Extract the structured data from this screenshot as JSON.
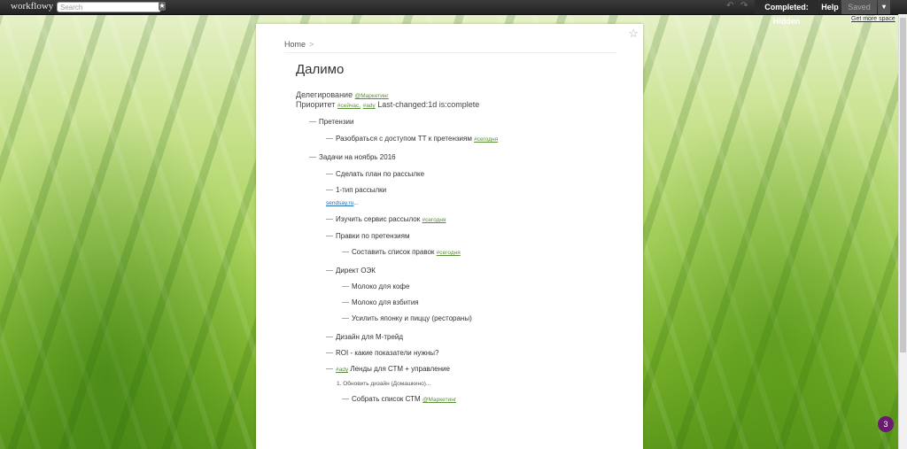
{
  "topbar": {
    "logo": "workflowy",
    "search_placeholder": "Search",
    "completed": "Completed: Hidden",
    "help": "Help",
    "saved": "Saved",
    "more_space": "Get more space"
  },
  "icons": {
    "star": "star-icon",
    "undo": "undo-icon",
    "redo": "redo-icon",
    "dropdown": "chevron-down-icon"
  },
  "page": {
    "breadcrumb": "Home",
    "breadcrumb_sep": ">",
    "title": "Далимо",
    "note_line1": "Делегирование",
    "note_line1_mention": "@Маркетинг",
    "note_line2": "Приоритет",
    "note_line2_tag1": "#сейчас,",
    "note_line2_tag2": "#ady",
    "note_line2_rest": "Last-changed:1d is:complete",
    "items": [
      {
        "text": "Претензии"
      },
      {
        "text": "Разобраться с доступом ТТ к претензиям",
        "tag": "#сегодня"
      },
      {
        "text": "Задачи на ноябрь 2016"
      },
      {
        "text": "Сделать план по рассылке"
      },
      {
        "text": "1-тип рассылки"
      },
      {
        "link": "sendsay.ru",
        "tail": "..."
      },
      {
        "text": "Изучить сервис рассылок",
        "tag": "#сегодня"
      },
      {
        "text": "Правки по претензиям"
      },
      {
        "text": "Составить список правок",
        "tag": "#сегодня"
      },
      {
        "text": "Директ ОЭК"
      },
      {
        "text": "Молоко для кофе"
      },
      {
        "text": "Молоко для взбития"
      },
      {
        "text": "Усилить японку и пиццу (рестораны)"
      },
      {
        "text": "Дизайн для М-трейд"
      },
      {
        "text": "ROI - какие показатели нужны?"
      },
      {
        "tag_prefix": "#ady",
        "text": "Ленды для СТМ + управление"
      },
      {
        "text": "1. Обновить дизайн (Домашкино)..."
      },
      {
        "text": "Собрать список СТМ",
        "mention": "@Маркетинг"
      }
    ]
  },
  "badge_count": "3",
  "colors": {
    "topbar": "#2b2b2b",
    "tag": "#5a8f3a",
    "link": "#2a6db5",
    "badge": "#6a1b6f"
  }
}
